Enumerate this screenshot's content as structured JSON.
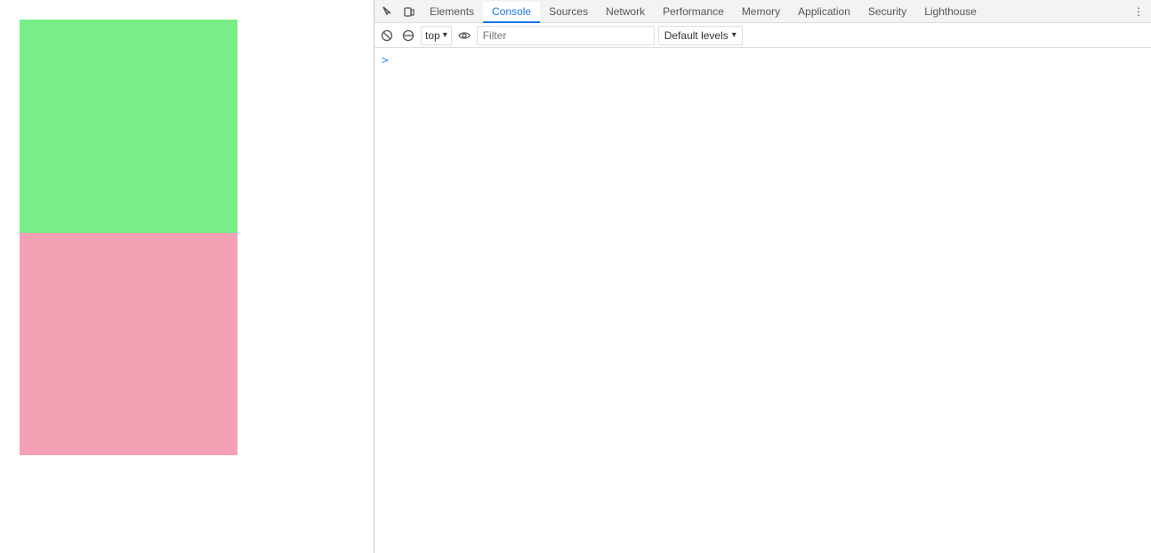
{
  "webpage": {
    "green_box_color": "#77ee88",
    "pink_box_color": "#f4a0b5"
  },
  "devtools": {
    "tabs": [
      {
        "id": "elements",
        "label": "Elements",
        "active": false
      },
      {
        "id": "console",
        "label": "Console",
        "active": true
      },
      {
        "id": "sources",
        "label": "Sources",
        "active": false
      },
      {
        "id": "network",
        "label": "Network",
        "active": false
      },
      {
        "id": "performance",
        "label": "Performance",
        "active": false
      },
      {
        "id": "memory",
        "label": "Memory",
        "active": false
      },
      {
        "id": "application",
        "label": "Application",
        "active": false
      },
      {
        "id": "security",
        "label": "Security",
        "active": false
      },
      {
        "id": "lighthouse",
        "label": "Lighthouse",
        "active": false
      }
    ],
    "console": {
      "context": "top",
      "filter_placeholder": "Filter",
      "levels_label": "Default levels",
      "prompt_symbol": ">"
    }
  },
  "icons": {
    "inspect": "⬚",
    "device": "▭",
    "clear": "🚫",
    "eye": "👁",
    "more": "⋮",
    "chevron_down": "▾",
    "chevron_right": "❯"
  }
}
